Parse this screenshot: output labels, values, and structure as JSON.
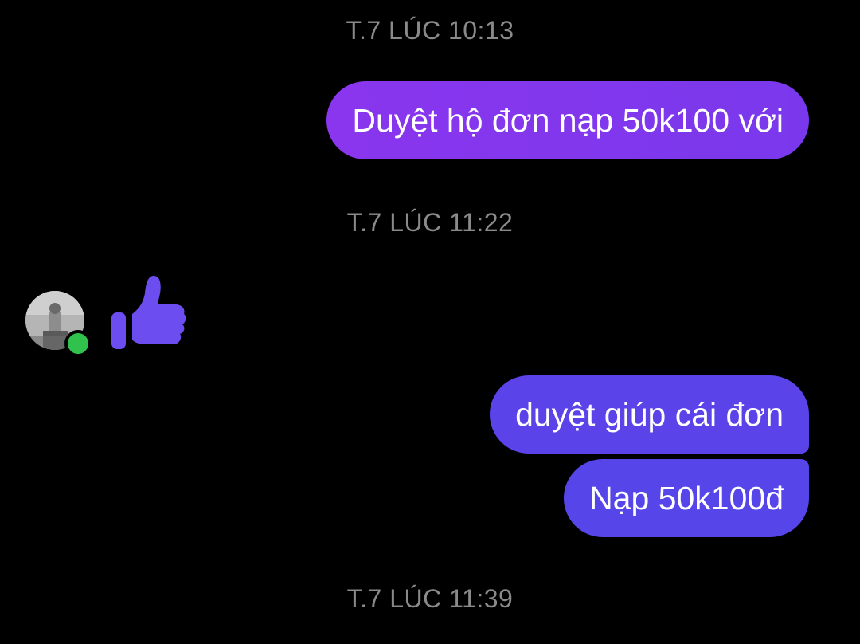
{
  "thread": {
    "timestamps": [
      "T.7 LÚC 10:13",
      "T.7 LÚC 11:22",
      "T.7 LÚC 11:39"
    ],
    "messages": [
      {
        "sender": "me",
        "text": "Duyệt hộ đơn nạp 50k100 với"
      },
      {
        "sender": "contact",
        "type": "like-reaction"
      },
      {
        "sender": "me",
        "text": "duyệt giúp cái đơn"
      },
      {
        "sender": "me",
        "text": "Nạp 50k100đ"
      }
    ]
  },
  "contact": {
    "status": "online",
    "avatar": "contact-avatar-photo"
  },
  "icons": {
    "like": "thumbs-up-icon"
  },
  "colors": {
    "background": "#000000",
    "timestamp": "#8a8a8d",
    "bubble_1": "#8236ed",
    "bubble_2": "#5b43ea",
    "bubble_3": "#5646ea",
    "like_icon": "#6c4df0",
    "online_dot": "#31c24d"
  }
}
